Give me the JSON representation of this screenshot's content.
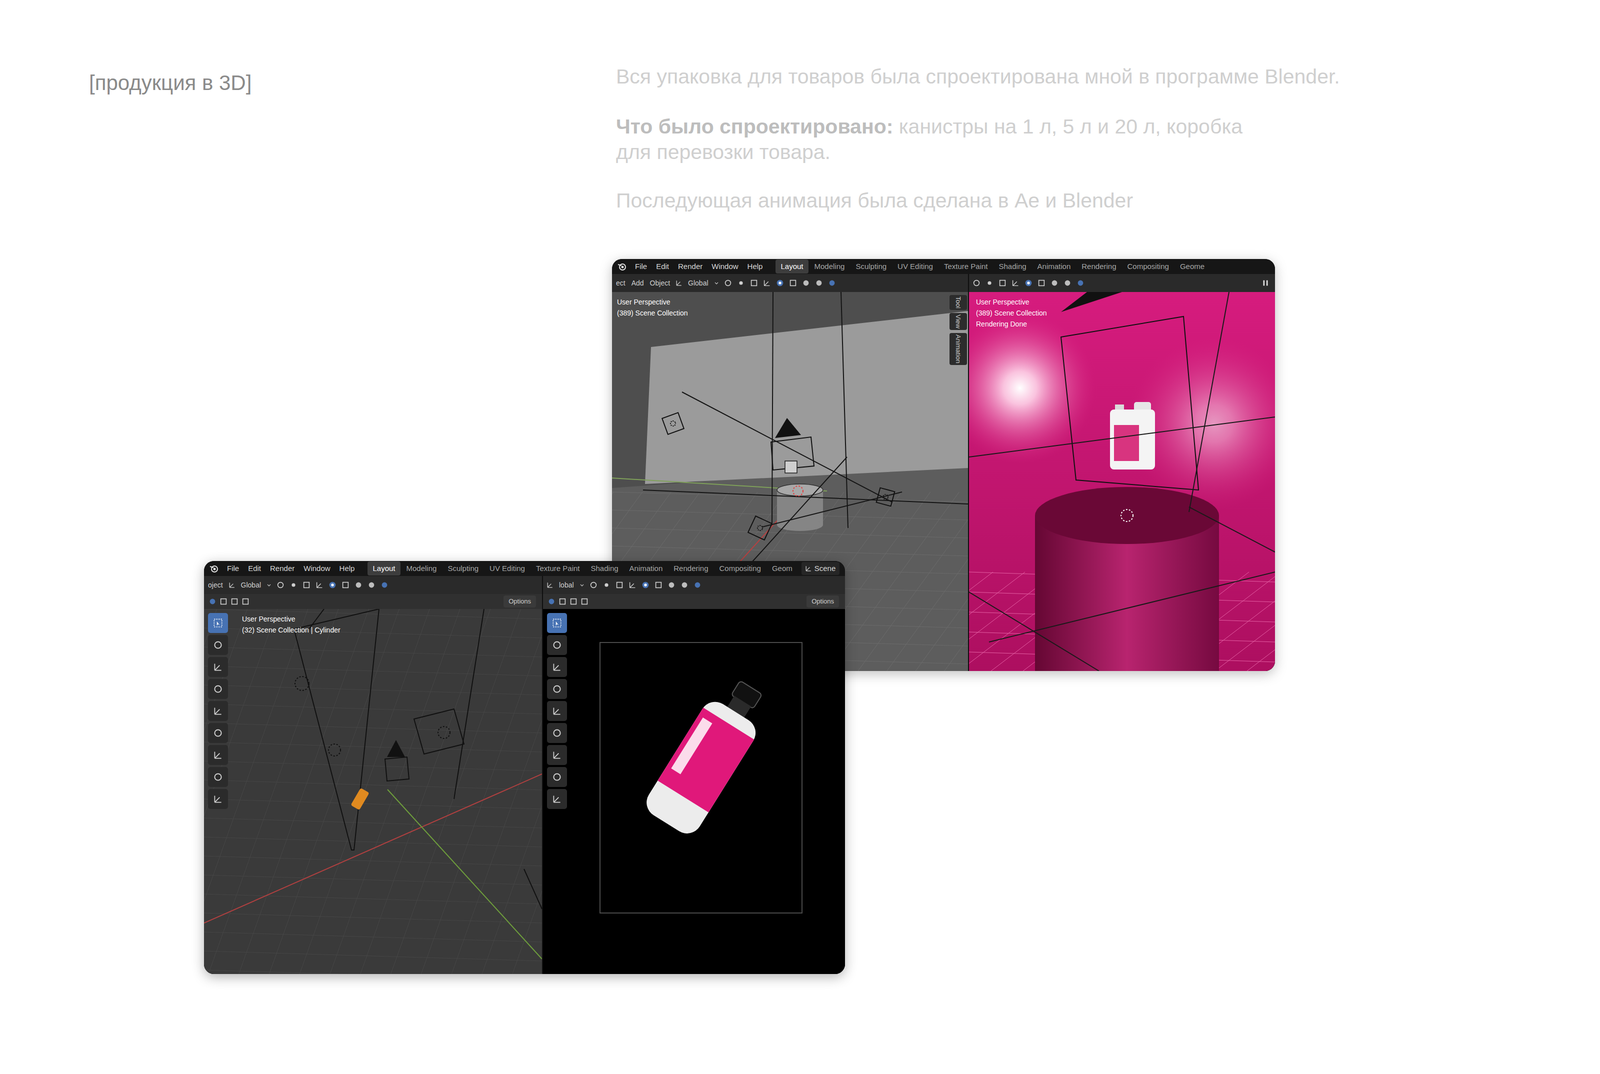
{
  "page": {
    "section_label": "[продукция в 3D]",
    "intro": "Вся упаковка для товаров была спроектирована мной в программе Blender.",
    "designed_label": "Что было спроектировано:",
    "designed_lines": [
      "канистры на 1 л, 5 л и 20 л, коробка",
      "для перевозки товара."
    ],
    "animation": "Последующая анимация была сделана в Ae и Blender"
  },
  "windows": [
    {
      "menu": [
        "File",
        "Edit",
        "Render",
        "Window",
        "Help"
      ],
      "workspaces": [
        {
          "label": "Layout",
          "selected": true
        },
        {
          "label": "Modeling",
          "selected": false
        },
        {
          "label": "Sculpting",
          "selected": false
        },
        {
          "label": "UV Editing",
          "selected": false
        },
        {
          "label": "Texture Paint",
          "selected": false
        },
        {
          "label": "Shading",
          "selected": false
        },
        {
          "label": "Animation",
          "selected": false
        },
        {
          "label": "Rendering",
          "selected": false
        },
        {
          "label": "Compositing",
          "selected": false
        },
        {
          "label": "Geome",
          "selected": false
        }
      ],
      "viewports": [
        {
          "kind": "scene-grey",
          "header": [
            "ect",
            "Add",
            "Object",
            "Global"
          ],
          "overlay": [
            "User Perspective",
            "(389) Scene Collection"
          ],
          "side_tabs": [
            "Tool",
            "View",
            "Animation"
          ]
        },
        {
          "kind": "render-pink",
          "header": [],
          "overlay": [
            "User Perspective",
            "(389) Scene Collection",
            "Rendering Done"
          ],
          "side_tabs": []
        }
      ]
    },
    {
      "menu": [
        "File",
        "Edit",
        "Render",
        "Window",
        "Help"
      ],
      "workspaces": [
        {
          "label": "Layout",
          "selected": true
        },
        {
          "label": "Modeling",
          "selected": false
        },
        {
          "label": "Sculpting",
          "selected": false
        },
        {
          "label": "UV Editing",
          "selected": false
        },
        {
          "label": "Texture Paint",
          "selected": false
        },
        {
          "label": "Shading",
          "selected": false
        },
        {
          "label": "Animation",
          "selected": false
        },
        {
          "label": "Rendering",
          "selected": false
        },
        {
          "label": "Compositing",
          "selected": false
        },
        {
          "label": "Geom",
          "selected": false
        }
      ],
      "scene": "Scene",
      "viewports": [
        {
          "kind": "scene-dark",
          "header": [
            "oject",
            "Global"
          ],
          "options": "Options",
          "overlay": [
            "User Perspective",
            "(32) Scene Collection | Cylinder"
          ],
          "side_tabs": []
        },
        {
          "kind": "render-black",
          "header": [
            "lobal"
          ],
          "options": "Options",
          "overlay": [],
          "side_tabs": []
        }
      ]
    }
  ]
}
